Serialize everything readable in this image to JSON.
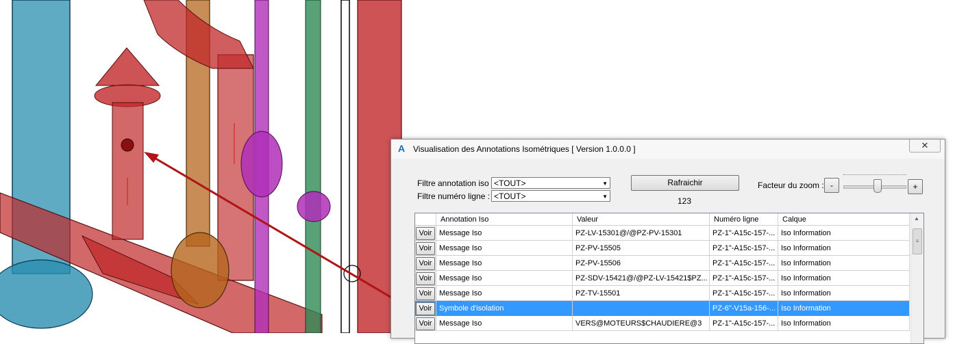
{
  "dialog": {
    "title": "Visualisation des Annotations Isométriques [ Version 1.0.0.0 ]",
    "close_label": "✕",
    "filter_annotation_label": "Filtre annotation iso :",
    "filter_annotation_value": "<TOUT>",
    "filter_line_label": "Filtre numéro ligne :",
    "filter_line_value": "<TOUT>",
    "refresh_label": "Rafraichir",
    "count": "123",
    "zoom_label": "Facteur du zoom :",
    "zoom_minus": "-",
    "zoom_plus": "+",
    "zoom_level": 0.55
  },
  "grid": {
    "columns": [
      "",
      "Annotation Iso",
      "Valeur",
      "Numéro ligne",
      "Calque"
    ],
    "button_label": "Voir",
    "rows": [
      {
        "annotation": "Message Iso",
        "valeur": "PZ-LV-15301@/@PZ-PV-15301",
        "numero": "PZ-1\"-A15c-157-...",
        "calque": "Iso Information",
        "selected": false
      },
      {
        "annotation": "Message Iso",
        "valeur": "PZ-PV-15505",
        "numero": "PZ-1\"-A15c-157-...",
        "calque": "Iso Information",
        "selected": false
      },
      {
        "annotation": "Message Iso",
        "valeur": "PZ-PV-15506",
        "numero": "PZ-1\"-A15c-157-...",
        "calque": "Iso Information",
        "selected": false
      },
      {
        "annotation": "Message Iso",
        "valeur": "PZ-SDV-15421@/@PZ-LV-15421$PZ...",
        "numero": "PZ-1\"-A15c-157-...",
        "calque": "Iso Information",
        "selected": false
      },
      {
        "annotation": "Message Iso",
        "valeur": "PZ-TV-15501",
        "numero": "PZ-1\"-A15c-157-...",
        "calque": "Iso Information",
        "selected": false
      },
      {
        "annotation": "Symbole d'isolation",
        "valeur": "",
        "numero": "PZ-6\"-V15a-156-...",
        "calque": "Iso Information",
        "selected": true
      },
      {
        "annotation": "Message Iso",
        "valeur": "VERS@MOTEURS$CHAUDIERE@3",
        "numero": "PZ-1\"-A15c-157-...",
        "calque": "Iso Information",
        "selected": false
      }
    ]
  },
  "colors": {
    "selection": "#3399ff",
    "pipe_red": "#c0282a",
    "pipe_blue": "#2a8fb0",
    "pipe_orange": "#b5651d",
    "pipe_purple": "#b02fb8",
    "pipe_green": "#2f8a55",
    "arrow": "#b01414"
  },
  "icons": {
    "app": "autocad-a-icon",
    "close": "close-icon",
    "dropdown": "dropdown-arrow-icon",
    "scroll_up": "scroll-up-arrow-icon"
  }
}
